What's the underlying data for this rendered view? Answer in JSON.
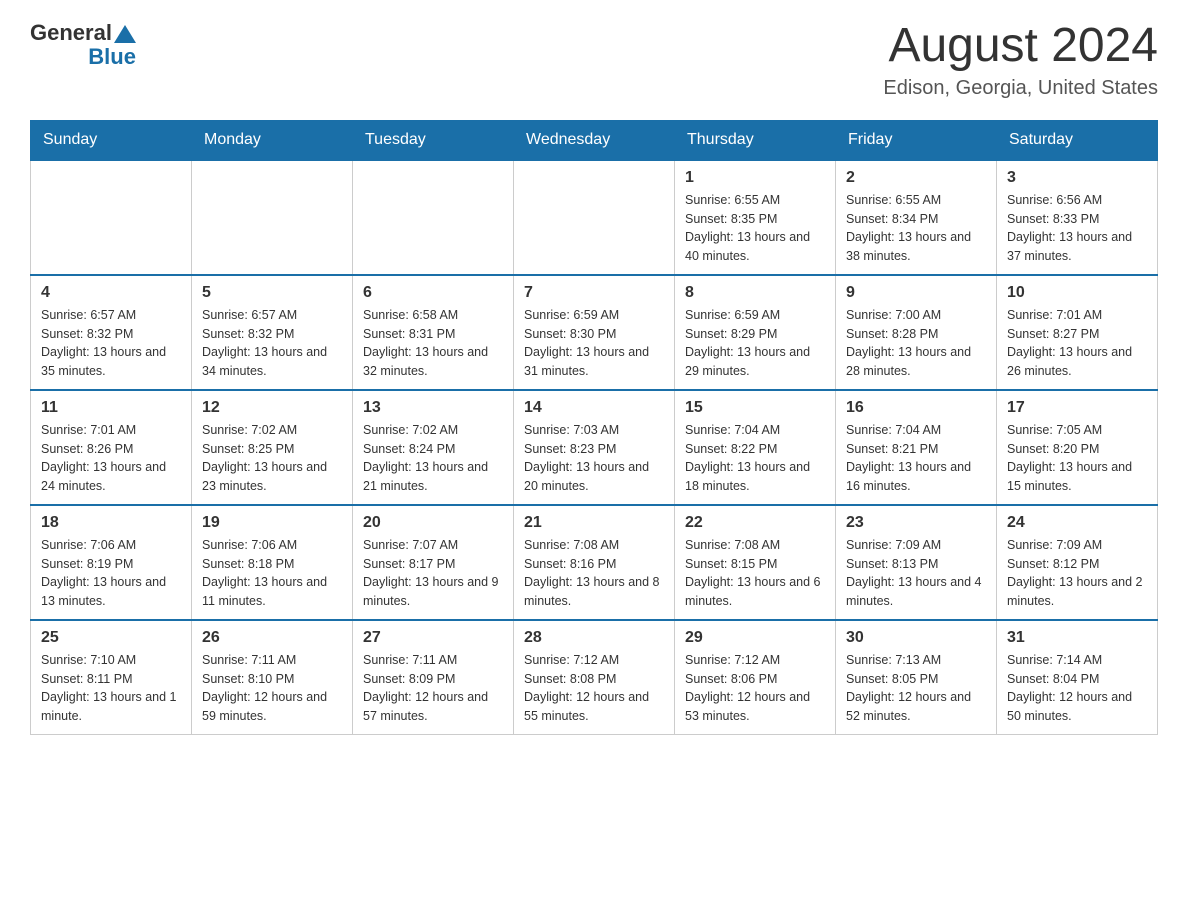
{
  "header": {
    "logo": {
      "general": "General",
      "blue": "Blue"
    },
    "title": "August 2024",
    "location": "Edison, Georgia, United States"
  },
  "days_of_week": [
    "Sunday",
    "Monday",
    "Tuesday",
    "Wednesday",
    "Thursday",
    "Friday",
    "Saturday"
  ],
  "weeks": [
    [
      {
        "day": "",
        "info": ""
      },
      {
        "day": "",
        "info": ""
      },
      {
        "day": "",
        "info": ""
      },
      {
        "day": "",
        "info": ""
      },
      {
        "day": "1",
        "info": "Sunrise: 6:55 AM\nSunset: 8:35 PM\nDaylight: 13 hours and 40 minutes."
      },
      {
        "day": "2",
        "info": "Sunrise: 6:55 AM\nSunset: 8:34 PM\nDaylight: 13 hours and 38 minutes."
      },
      {
        "day": "3",
        "info": "Sunrise: 6:56 AM\nSunset: 8:33 PM\nDaylight: 13 hours and 37 minutes."
      }
    ],
    [
      {
        "day": "4",
        "info": "Sunrise: 6:57 AM\nSunset: 8:32 PM\nDaylight: 13 hours and 35 minutes."
      },
      {
        "day": "5",
        "info": "Sunrise: 6:57 AM\nSunset: 8:32 PM\nDaylight: 13 hours and 34 minutes."
      },
      {
        "day": "6",
        "info": "Sunrise: 6:58 AM\nSunset: 8:31 PM\nDaylight: 13 hours and 32 minutes."
      },
      {
        "day": "7",
        "info": "Sunrise: 6:59 AM\nSunset: 8:30 PM\nDaylight: 13 hours and 31 minutes."
      },
      {
        "day": "8",
        "info": "Sunrise: 6:59 AM\nSunset: 8:29 PM\nDaylight: 13 hours and 29 minutes."
      },
      {
        "day": "9",
        "info": "Sunrise: 7:00 AM\nSunset: 8:28 PM\nDaylight: 13 hours and 28 minutes."
      },
      {
        "day": "10",
        "info": "Sunrise: 7:01 AM\nSunset: 8:27 PM\nDaylight: 13 hours and 26 minutes."
      }
    ],
    [
      {
        "day": "11",
        "info": "Sunrise: 7:01 AM\nSunset: 8:26 PM\nDaylight: 13 hours and 24 minutes."
      },
      {
        "day": "12",
        "info": "Sunrise: 7:02 AM\nSunset: 8:25 PM\nDaylight: 13 hours and 23 minutes."
      },
      {
        "day": "13",
        "info": "Sunrise: 7:02 AM\nSunset: 8:24 PM\nDaylight: 13 hours and 21 minutes."
      },
      {
        "day": "14",
        "info": "Sunrise: 7:03 AM\nSunset: 8:23 PM\nDaylight: 13 hours and 20 minutes."
      },
      {
        "day": "15",
        "info": "Sunrise: 7:04 AM\nSunset: 8:22 PM\nDaylight: 13 hours and 18 minutes."
      },
      {
        "day": "16",
        "info": "Sunrise: 7:04 AM\nSunset: 8:21 PM\nDaylight: 13 hours and 16 minutes."
      },
      {
        "day": "17",
        "info": "Sunrise: 7:05 AM\nSunset: 8:20 PM\nDaylight: 13 hours and 15 minutes."
      }
    ],
    [
      {
        "day": "18",
        "info": "Sunrise: 7:06 AM\nSunset: 8:19 PM\nDaylight: 13 hours and 13 minutes."
      },
      {
        "day": "19",
        "info": "Sunrise: 7:06 AM\nSunset: 8:18 PM\nDaylight: 13 hours and 11 minutes."
      },
      {
        "day": "20",
        "info": "Sunrise: 7:07 AM\nSunset: 8:17 PM\nDaylight: 13 hours and 9 minutes."
      },
      {
        "day": "21",
        "info": "Sunrise: 7:08 AM\nSunset: 8:16 PM\nDaylight: 13 hours and 8 minutes."
      },
      {
        "day": "22",
        "info": "Sunrise: 7:08 AM\nSunset: 8:15 PM\nDaylight: 13 hours and 6 minutes."
      },
      {
        "day": "23",
        "info": "Sunrise: 7:09 AM\nSunset: 8:13 PM\nDaylight: 13 hours and 4 minutes."
      },
      {
        "day": "24",
        "info": "Sunrise: 7:09 AM\nSunset: 8:12 PM\nDaylight: 13 hours and 2 minutes."
      }
    ],
    [
      {
        "day": "25",
        "info": "Sunrise: 7:10 AM\nSunset: 8:11 PM\nDaylight: 13 hours and 1 minute."
      },
      {
        "day": "26",
        "info": "Sunrise: 7:11 AM\nSunset: 8:10 PM\nDaylight: 12 hours and 59 minutes."
      },
      {
        "day": "27",
        "info": "Sunrise: 7:11 AM\nSunset: 8:09 PM\nDaylight: 12 hours and 57 minutes."
      },
      {
        "day": "28",
        "info": "Sunrise: 7:12 AM\nSunset: 8:08 PM\nDaylight: 12 hours and 55 minutes."
      },
      {
        "day": "29",
        "info": "Sunrise: 7:12 AM\nSunset: 8:06 PM\nDaylight: 12 hours and 53 minutes."
      },
      {
        "day": "30",
        "info": "Sunrise: 7:13 AM\nSunset: 8:05 PM\nDaylight: 12 hours and 52 minutes."
      },
      {
        "day": "31",
        "info": "Sunrise: 7:14 AM\nSunset: 8:04 PM\nDaylight: 12 hours and 50 minutes."
      }
    ]
  ]
}
